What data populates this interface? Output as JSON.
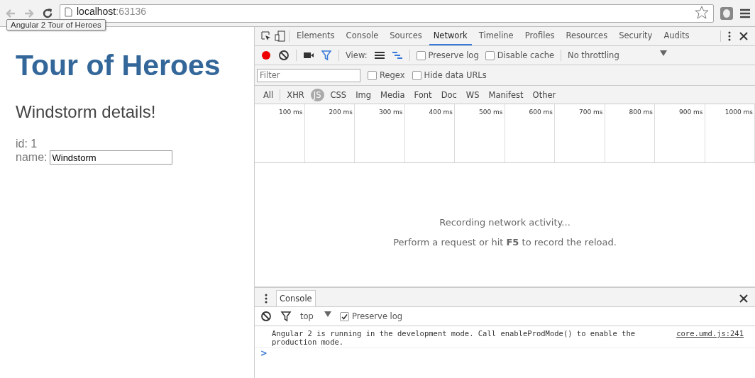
{
  "browser": {
    "url_host": "localhost",
    "url_port": ":63136",
    "tooltip": "Angular 2 Tour of Heroes"
  },
  "page": {
    "title": "Tour of Heroes",
    "heading": "Windstorm details!",
    "id_line": "id: 1",
    "name_label": "name:",
    "name_value": "Windstorm"
  },
  "devtools": {
    "tabs": [
      {
        "label": "Elements",
        "selected": false
      },
      {
        "label": "Console",
        "selected": false
      },
      {
        "label": "Sources",
        "selected": false
      },
      {
        "label": "Network",
        "selected": true
      },
      {
        "label": "Timeline",
        "selected": false
      },
      {
        "label": "Profiles",
        "selected": false
      },
      {
        "label": "Resources",
        "selected": false
      },
      {
        "label": "Security",
        "selected": false
      },
      {
        "label": "Audits",
        "selected": false
      }
    ],
    "toolbar": {
      "recording": true,
      "view_label": "View:",
      "preserve_log": {
        "label": "Preserve log",
        "checked": false
      },
      "disable_cache": {
        "label": "Disable cache",
        "checked": false
      },
      "throttling": "No throttling"
    },
    "filter": {
      "placeholder": "Filter",
      "regex": {
        "label": "Regex",
        "checked": false
      },
      "hide_data_urls": {
        "label": "Hide data URLs",
        "checked": false
      }
    },
    "types": [
      {
        "label": "All",
        "selected": false
      },
      {
        "label": "XHR",
        "selected": false
      },
      {
        "label": "JS",
        "selected": true
      },
      {
        "label": "CSS",
        "selected": false
      },
      {
        "label": "Img",
        "selected": false
      },
      {
        "label": "Media",
        "selected": false
      },
      {
        "label": "Font",
        "selected": false
      },
      {
        "label": "Doc",
        "selected": false
      },
      {
        "label": "WS",
        "selected": false
      },
      {
        "label": "Manifest",
        "selected": false
      },
      {
        "label": "Other",
        "selected": false
      }
    ],
    "timeline_ticks": [
      "100 ms",
      "200 ms",
      "300 ms",
      "400 ms",
      "500 ms",
      "600 ms",
      "700 ms",
      "800 ms",
      "900 ms",
      "1000 ms"
    ],
    "empty_state": [
      "Recording network activity...",
      "Perform a request or hit **F5** to record the reload."
    ],
    "drawer": {
      "tab": "Console",
      "context": "top",
      "preserve_log": {
        "label": "Preserve log",
        "checked": true
      },
      "messages": [
        {
          "text": "Angular 2 is running in the development mode. Call enableProdMode() to enable the production mode.",
          "source": "core.umd.js:241"
        }
      ],
      "prompt": ">"
    }
  }
}
